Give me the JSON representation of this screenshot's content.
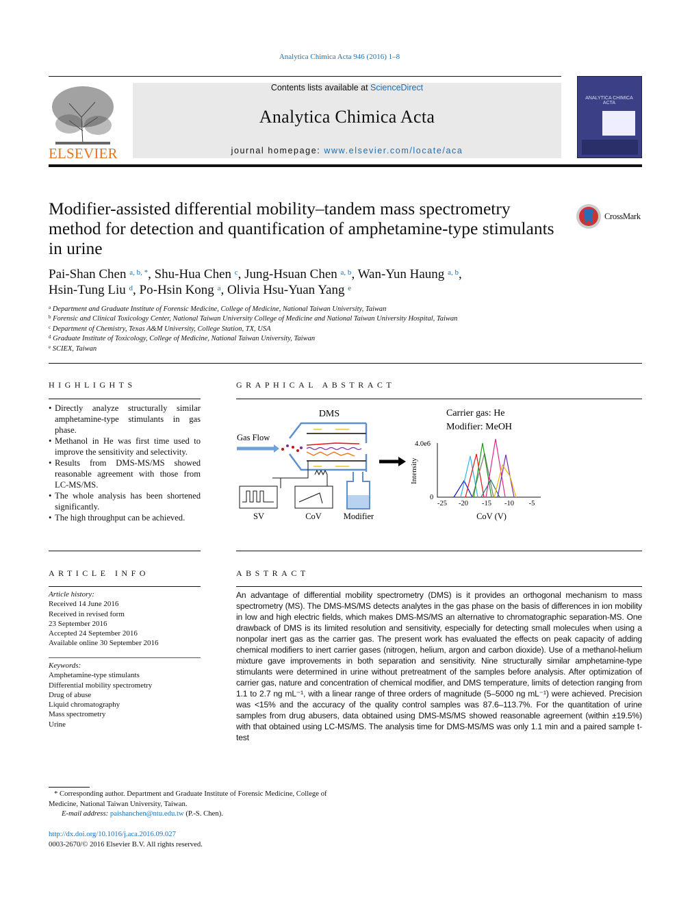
{
  "running_head": "Analytica Chimica Acta 946 (2016) 1–8",
  "header": {
    "publisher_logo_text": "ELSEVIER",
    "contents_prefix": "Contents lists available at ",
    "contents_link": "ScienceDirect",
    "journal_title": "Analytica Chimica Acta",
    "homepage_prefix": "journal homepage: ",
    "homepage_link": "www.elsevier.com/locate/aca",
    "cover_text": "ANALYTICA CHIMICA ACTA"
  },
  "crossmark": "CrossMark",
  "article": {
    "title": "Modifier-assisted differential mobility–tandem mass spectrometry method for detection and quantification of amphetamine-type stimulants in urine",
    "authors": [
      {
        "name": "Pai-Shan Chen",
        "sup": "a, b, *"
      },
      {
        "name": "Shu-Hua Chen",
        "sup": "c"
      },
      {
        "name": "Jung-Hsuan Chen",
        "sup": "a, b"
      },
      {
        "name": "Wan-Yun Haung",
        "sup": "a, b"
      },
      {
        "name": "Hsin-Tung Liu",
        "sup": "d"
      },
      {
        "name": "Po-Hsin Kong",
        "sup": "a"
      },
      {
        "name": "Olivia Hsu-Yuan Yang",
        "sup": "e"
      }
    ],
    "affiliations": [
      {
        "key": "a",
        "text": "Department and Graduate Institute of Forensic Medicine, College of Medicine, National Taiwan University, Taiwan"
      },
      {
        "key": "b",
        "text": "Forensic and Clinical Toxicology Center, National Taiwan University College of Medicine and National Taiwan University Hospital, Taiwan"
      },
      {
        "key": "c",
        "text": "Department of Chemistry, Texas A&M University, College Station, TX, USA"
      },
      {
        "key": "d",
        "text": "Graduate Institute of Toxicology, College of Medicine, National Taiwan University, Taiwan"
      },
      {
        "key": "e",
        "text": "SCIEX, Taiwan"
      }
    ]
  },
  "highlights": {
    "heading": "HIGHLIGHTS",
    "items": [
      "Directly analyze structurally similar amphetamine-type stimulants in gas phase.",
      "Methanol in He was first time used to improve the sensitivity and selectivity.",
      "Results from DMS-MS/MS showed reasonable agreement with those from LC-MS/MS.",
      "The whole analysis has been shortened significantly.",
      "The high throughput can be achieved."
    ]
  },
  "graphical_abstract": {
    "heading": "GRAPHICAL ABSTRACT",
    "dms": "DMS",
    "gas_flow": "Gas Flow",
    "sv": "SV",
    "cov": "CoV",
    "modifier": "Modifier",
    "carrier": "Carrier gas: He",
    "modifier_gas": "Modifier: MeOH",
    "y_label": "Intensity",
    "y_max": "4.0e6",
    "y_zero": "0",
    "x_label": "CoV (V)",
    "x_ticks": [
      "-25",
      "-20",
      "-15",
      "-10",
      "-5"
    ]
  },
  "article_info": {
    "heading": "ARTICLE INFO",
    "history_label": "Article history:",
    "history": [
      "Received 14 June 2016",
      "Received in revised form",
      "23 September 2016",
      "Accepted 24 September 2016",
      "Available online 30 September 2016"
    ],
    "keywords_label": "Keywords:",
    "keywords": [
      "Amphetamine-type stimulants",
      "Differential mobility spectrometry",
      "Drug of abuse",
      "Liquid chromatography",
      "Mass spectrometry",
      "Urine"
    ]
  },
  "abstract": {
    "heading": "ABSTRACT",
    "text": "An advantage of differential mobility spectrometry (DMS) is it provides an orthogonal mechanism to mass spectrometry (MS). The DMS-MS/MS detects analytes in the gas phase on the basis of differences in ion mobility in low and high electric fields, which makes DMS-MS/MS an alternative to chromatographic separation-MS. One drawback of DMS is its limited resolution and sensitivity, especially for detecting small molecules when using a nonpolar inert gas as the carrier gas. The present work has evaluated the effects on peak capacity of adding chemical modifiers to inert carrier gases (nitrogen, helium, argon and carbon dioxide). Use of a methanol-helium mixture gave improvements in both separation and sensitivity. Nine structurally similar amphetamine-type stimulants were determined in urine without pretreatment of the samples before analysis. After optimization of carrier gas, nature and concentration of chemical modifier, and DMS temperature, limits of detection ranging from 1.1 to 2.7 ng mL⁻¹, with a linear range of three orders of magnitude (5–5000 ng mL⁻¹) were achieved. Precision was <15% and the accuracy of the quality control samples was 87.6–113.7%. For the quantitation of urine samples from drug abusers, data obtained using DMS-MS/MS showed reasonable agreement (within ±19.5%) with that obtained using LC-MS/MS. The analysis time for DMS-MS/MS was only 1.1 min and a paired sample t-test"
  },
  "footnote": {
    "star": "*",
    "corresponding": "Corresponding author. Department and Graduate Institute of Forensic Medicine, College of Medicine, National Taiwan University, Taiwan.",
    "email_label": "E-mail address:",
    "email": "paishanchen@ntu.edu.tw",
    "email_suffix": "(P.-S. Chen)."
  },
  "doi": "http://dx.doi.org/10.1016/j.aca.2016.09.027",
  "copyright": "0003-2670/© 2016 Elsevier B.V. All rights reserved."
}
